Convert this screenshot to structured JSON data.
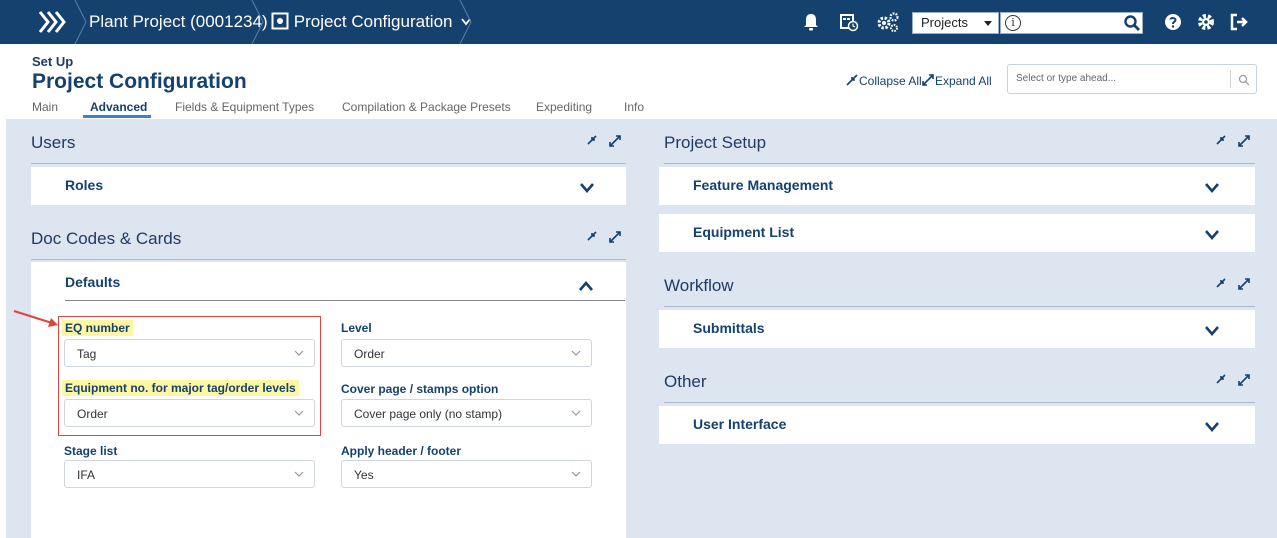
{
  "topbar": {
    "breadcrumb": [
      "Plant Project (0001234)",
      "Project Configuration"
    ],
    "projects_select": "Projects",
    "search_info": "i",
    "icons": [
      "menu-chevrons-icon",
      "bell-icon",
      "calendar-clock-icon",
      "gears-icon",
      "question-icon",
      "gear-icon",
      "logout-icon"
    ]
  },
  "header": {
    "setup_label": "Set Up",
    "title": "Project Configuration",
    "collapse_all": "Collapse All",
    "expand_all": "Expand All",
    "search_placeholder": "Select or type ahead..."
  },
  "tabs": [
    {
      "label": "Main",
      "active": false
    },
    {
      "label": "Advanced",
      "active": true
    },
    {
      "label": "Fields & Equipment Types",
      "active": false
    },
    {
      "label": "Compilation & Package Presets",
      "active": false
    },
    {
      "label": "Expediting",
      "active": false
    },
    {
      "label": "Info",
      "active": false
    }
  ],
  "left": {
    "users": {
      "title": "Users",
      "cards": [
        {
          "label": "Roles"
        }
      ]
    },
    "doc_codes": {
      "title": "Doc Codes & Cards",
      "defaults": {
        "title": "Defaults",
        "fields": [
          {
            "label": "EQ number",
            "value": "Tag"
          },
          {
            "label": "Level",
            "value": "Order"
          },
          {
            "label": "Equipment no. for major tag/order levels",
            "value": "Order"
          },
          {
            "label": "Cover page / stamps option",
            "value": "Cover page only (no stamp)"
          },
          {
            "label": "Stage list",
            "value": "IFA"
          },
          {
            "label": "Apply header / footer",
            "value": "Yes"
          }
        ]
      }
    }
  },
  "right": {
    "project_setup": {
      "title": "Project Setup",
      "cards": [
        {
          "label": "Feature Management"
        },
        {
          "label": "Equipment List"
        }
      ]
    },
    "workflow": {
      "title": "Workflow",
      "cards": [
        {
          "label": "Submittals"
        }
      ]
    },
    "other": {
      "title": "Other",
      "cards": [
        {
          "label": "User Interface"
        }
      ]
    }
  },
  "colors": {
    "navbar": "#15416f",
    "background": "#dde5f0",
    "highlight": "#fdf6a3",
    "annotation": "#e0443a",
    "accent": "#3a83c9"
  }
}
